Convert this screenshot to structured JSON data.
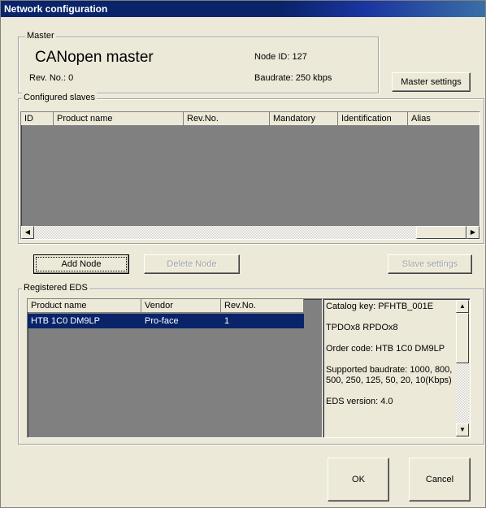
{
  "window": {
    "title": "Network configuration"
  },
  "master": {
    "group_label": "Master",
    "name": "CANopen master",
    "rev": "Rev. No.: 0",
    "node_id": "Node ID: 127",
    "baudrate": "Baudrate: 250 kbps",
    "settings_button": "Master settings"
  },
  "slaves": {
    "group_label": "Configured slaves",
    "columns": [
      "ID",
      "Product name",
      "Rev.No.",
      "Mandatory",
      "Identification",
      "Alias"
    ]
  },
  "actions": {
    "add_node": "Add Node",
    "delete_node": "Delete Node",
    "slave_settings": "Slave settings"
  },
  "eds": {
    "group_label": "Registered EDS",
    "columns": [
      "Product name",
      "Vendor",
      "Rev.No."
    ],
    "rows": [
      {
        "product": "HTB 1C0 DM9LP",
        "vendor": "Pro-face",
        "rev": "1",
        "selected": true
      }
    ],
    "details": [
      "Catalog key: PFHTB_001E",
      "TPDOx8 RPDOx8",
      "Order code: HTB 1C0 DM9LP",
      "Supported baudrate: 1000, 800, 500, 250, 125, 50, 20, 10(Kbps)",
      "EDS version: 4.0"
    ]
  },
  "footer": {
    "ok": "OK",
    "cancel": "Cancel"
  },
  "colors": {
    "title_bar": "#0a246a",
    "selection": "#0a246a",
    "list_empty_bg": "#808080",
    "dialog_bg": "#ece9d8"
  }
}
